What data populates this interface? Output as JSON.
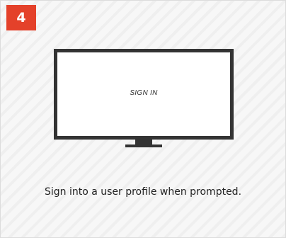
{
  "step": {
    "number": "4",
    "accent_color": "#e4412a"
  },
  "tv": {
    "icon": "tv-icon",
    "screen_text": "SIGN IN"
  },
  "instruction": "Sign into a user profile when prompted."
}
